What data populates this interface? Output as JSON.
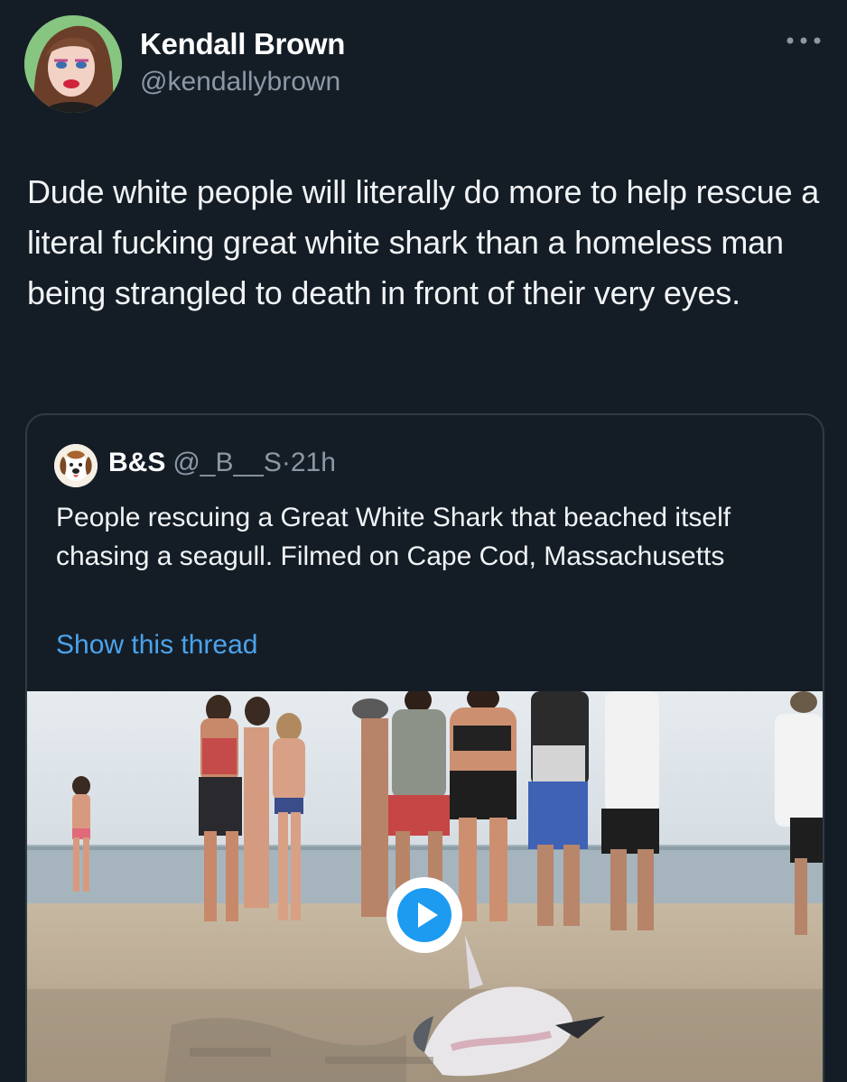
{
  "author": {
    "name": "Kendall Brown",
    "handle": "@kendallybrown",
    "avatar_icon": "profile-photo"
  },
  "more_icon": "ellipsis-icon",
  "tweet": {
    "text": "Dude white people will literally do more to help rescue a literal fucking great white shark than a homeless man being strangled to death in front of their very eyes."
  },
  "quoted": {
    "name": "B&S",
    "handle": "@_B__S",
    "time": "21h",
    "separator": "·",
    "text": "People rescuing a Great White Shark that beached itself chasing a seagull. Filmed on Cape Cod, Massachusetts",
    "link": "Show this thread",
    "avatar_icon": "beagle-dog-icon",
    "media_icon": "play-video-icon"
  },
  "colors": {
    "background": "#141d26",
    "secondary_text": "#8b98a5",
    "link": "#4ba3ec",
    "play_accent": "#1d9bf0"
  }
}
